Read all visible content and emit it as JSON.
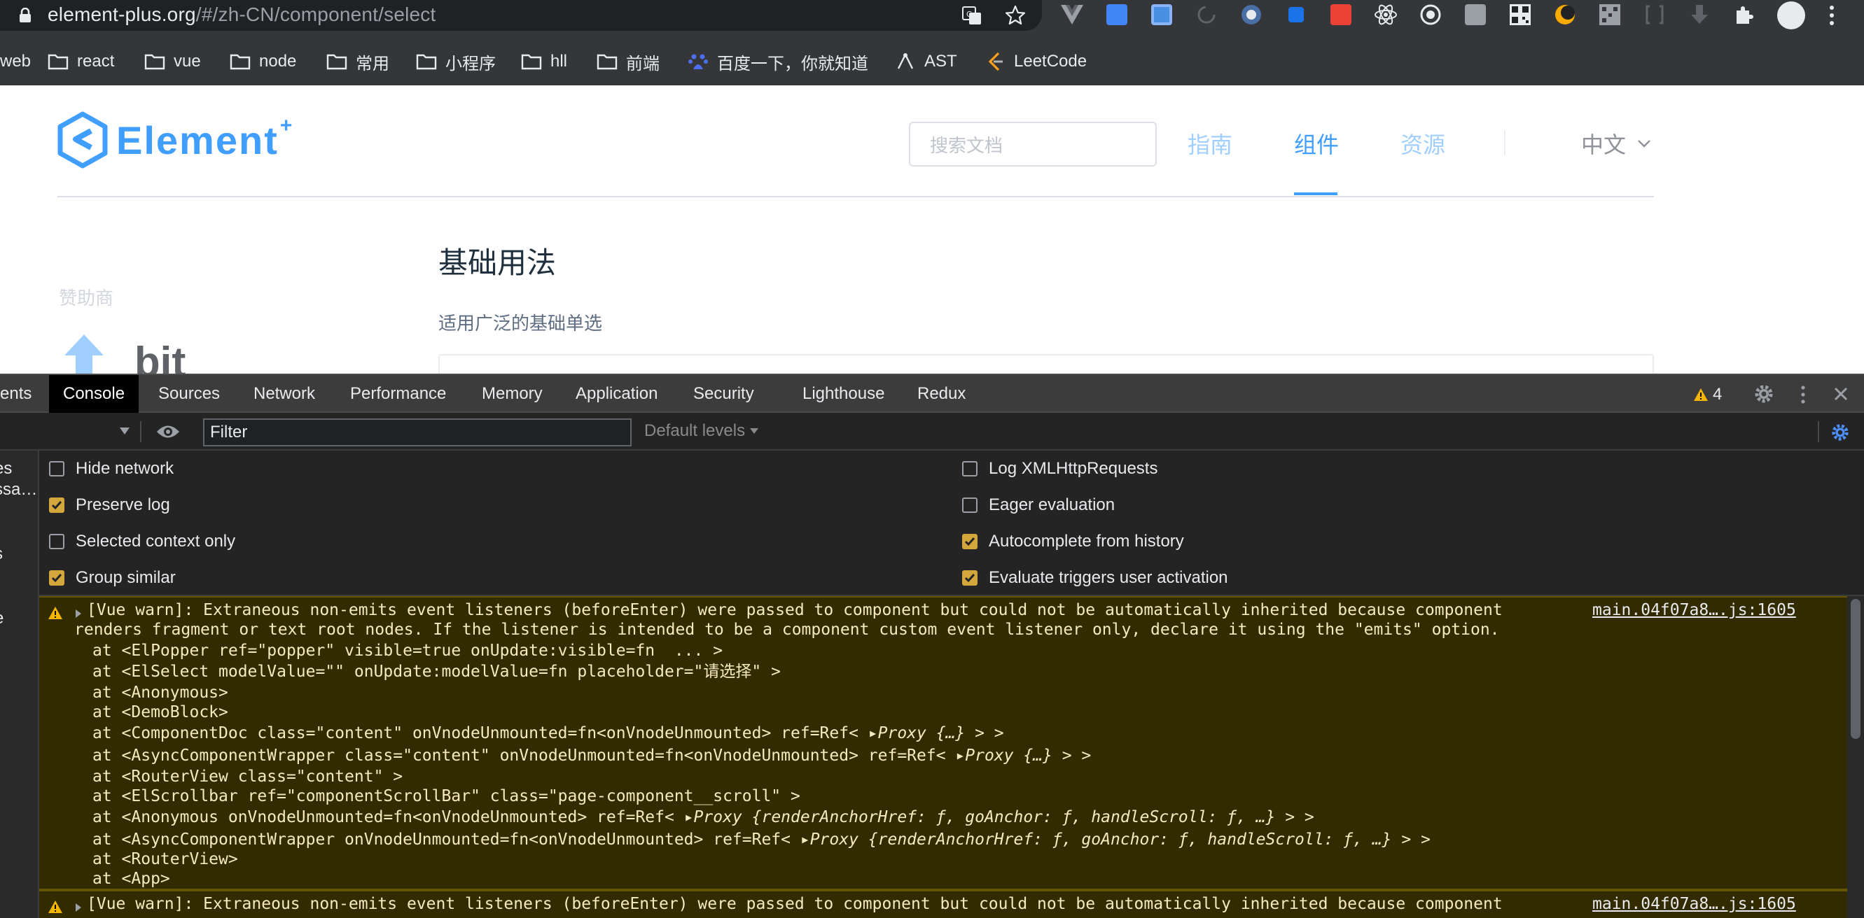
{
  "browser": {
    "url_host": "element-plus.org",
    "url_path": "/#/zh-CN/component/select",
    "bookmarks": [
      "web",
      "react",
      "vue",
      "node",
      "常用",
      "小程序",
      "hll",
      "前端",
      "百度一下，你就知道",
      "AST",
      "LeetCode"
    ]
  },
  "site": {
    "logo_text": "Element",
    "logo_plus": "+",
    "search_placeholder": "搜索文档",
    "nav": [
      "指南",
      "组件",
      "资源"
    ],
    "active_nav": "组件",
    "lang": "中文",
    "sponsor_label": "赞助商",
    "sponsor_name": "bit",
    "section_title": "基础用法",
    "section_desc": "适用广泛的基础单选",
    "brand_color": "#409eff"
  },
  "devtools": {
    "tabs": [
      "ents",
      "Console",
      "Sources",
      "Network",
      "Performance",
      "Memory",
      "Application",
      "Security",
      "Lighthouse",
      "Redux"
    ],
    "active_tab": "Console",
    "warning_count": "4",
    "filter_value": "Filter",
    "levels_label": "Default levels",
    "sidebar_items": [
      "es",
      "ssa…",
      "s",
      "e"
    ],
    "settings": {
      "hide_network": "Hide network",
      "preserve_log": "Preserve log",
      "selected_context": "Selected context only",
      "group_similar": "Group similar",
      "log_xhr": "Log XMLHttpRequests",
      "eager_eval": "Eager evaluation",
      "autocomplete": "Autocomplete from history",
      "eval_triggers": "Evaluate triggers user activation"
    },
    "messages": [
      {
        "line1": "[Vue warn]: Extraneous non-emits event listeners (beforeEnter) were passed to component but could not be automatically inherited because component",
        "line2": "renders fragment or text root nodes. If the listener is intended to be a component custom event listener only, declare it using the \"emits\" option.",
        "source": "main.04f07a8….js:1605",
        "trace": [
          "at <ElPopper ref=\"popper\" visible=true onUpdate:visible=fn  ... >",
          "at <ElSelect modelValue=\"\" onUpdate:modelValue=fn placeholder=\"请选择\" >",
          "at <Anonymous>",
          "at <DemoBlock>",
          "at <ComponentDoc class=\"content\" onVnodeUnmounted=fn<onVnodeUnmounted> ref=Ref< ",
          "at <AsyncComponentWrapper class=\"content\" onVnodeUnmounted=fn<onVnodeUnmounted> ref=Ref< ",
          "at <RouterView class=\"content\" >",
          "at <ElScrollbar ref=\"componentScrollBar\" class=\"page-component__scroll\" >",
          "at <Anonymous onVnodeUnmounted=fn<onVnodeUnmounted> ref=Ref< ",
          "at <AsyncComponentWrapper onVnodeUnmounted=fn<onVnodeUnmounted> ref=Ref< ",
          "at <RouterView>",
          "at <App>"
        ],
        "proxy_short": "Proxy {…}",
        "proxy_long": "Proxy {renderAnchorHref: ƒ, goAnchor: ƒ, handleScroll: ƒ, …}",
        "tail": " > >"
      },
      {
        "line1": "[Vue warn]: Extraneous non-emits event listeners (beforeEnter) were passed to component but could not be automatically inherited because component",
        "source": "main.04f07a8….js:1605"
      }
    ]
  }
}
